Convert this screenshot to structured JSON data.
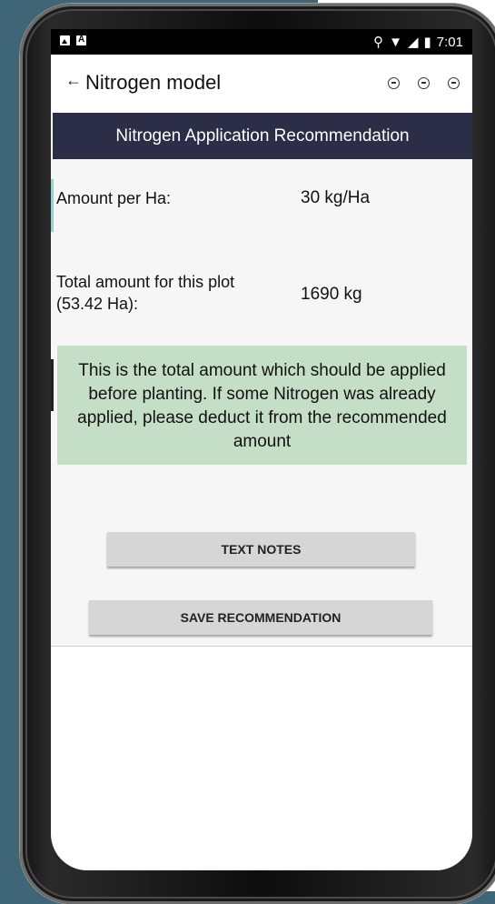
{
  "status_bar": {
    "time": "7:01"
  },
  "appbar": {
    "back_icon": "←",
    "title": "Nitrogen model"
  },
  "banner": {
    "title": "Nitrogen Application Recommendation"
  },
  "results": {
    "amount_per_ha_label": "Amount per Ha:",
    "amount_per_ha_value": "30 kg/Ha",
    "total_label_line1": "Total amount for this plot",
    "total_label_line2": "(53.42 Ha):",
    "total_value": "1690 kg"
  },
  "note": {
    "text": "This is the total amount which should be applied before planting. If some Nitrogen was already applied, please deduct it from the recommended amount"
  },
  "buttons": {
    "text_notes": "TEXT NOTES",
    "save_recommendation": "SAVE RECOMMENDATION"
  },
  "colors": {
    "banner": "#2c2e47",
    "note_background": "#c5dfc7",
    "button": "#d6d6d6",
    "background_left": "#3f6677"
  }
}
